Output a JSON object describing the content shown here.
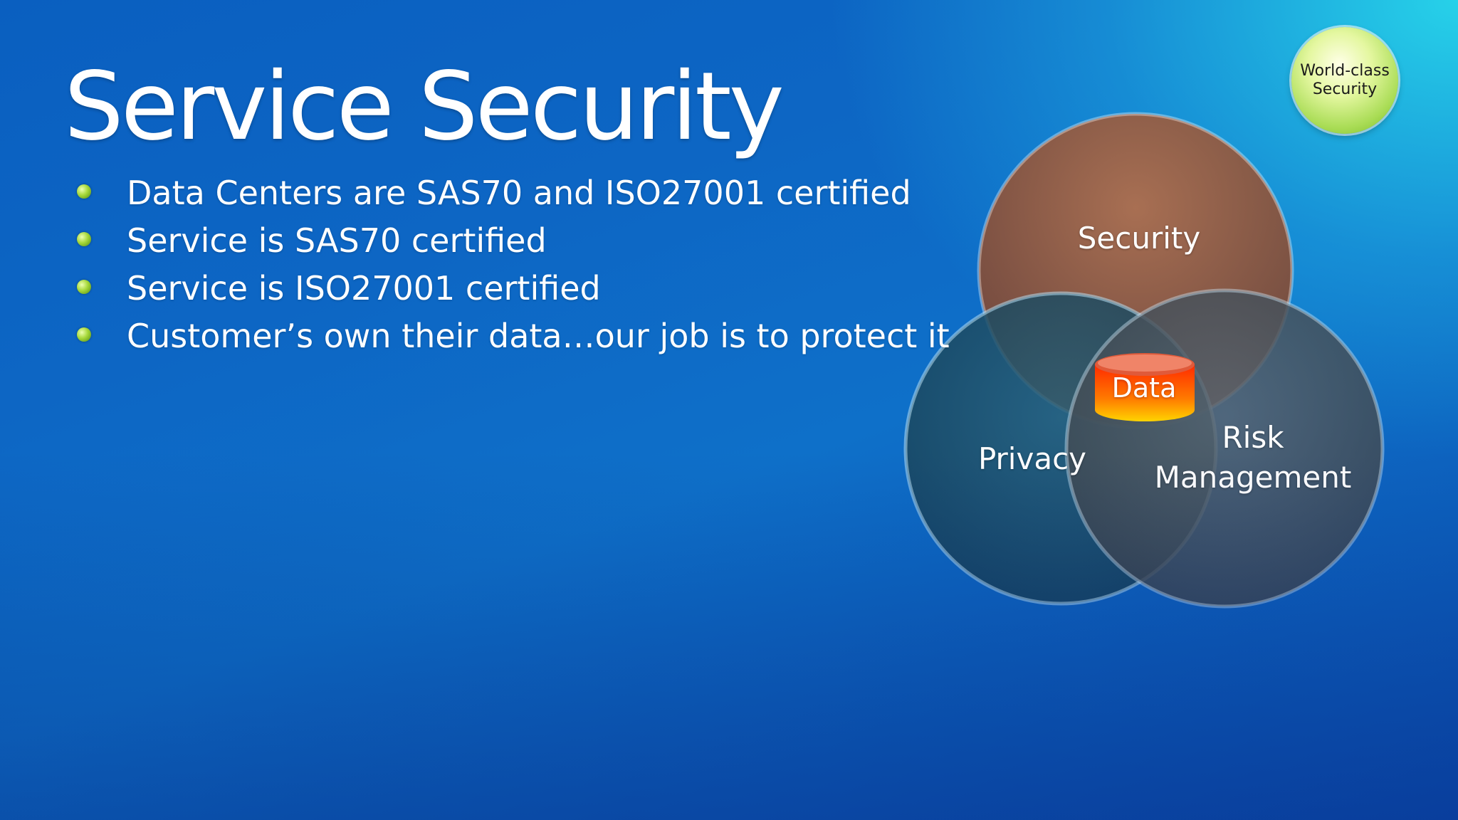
{
  "slide": {
    "title": "Service Security",
    "bullets": [
      "Data Centers are SAS70 and ISO27001 certified",
      "Service is SAS70 certified",
      "Service is ISO27001 certified",
      "Customer’s own their data…our job is to protect it"
    ]
  },
  "badge": {
    "line1": "World-class",
    "line2": "Security"
  },
  "venn": {
    "circles": [
      {
        "label": "Security",
        "color": "#9a5a3c"
      },
      {
        "label": "Privacy",
        "color": "#1d4f66"
      },
      {
        "label": "Risk Management",
        "color": "#4a5560"
      }
    ],
    "center_label": "Data",
    "center_icon": "database-icon",
    "center_color": "#f04a10"
  }
}
